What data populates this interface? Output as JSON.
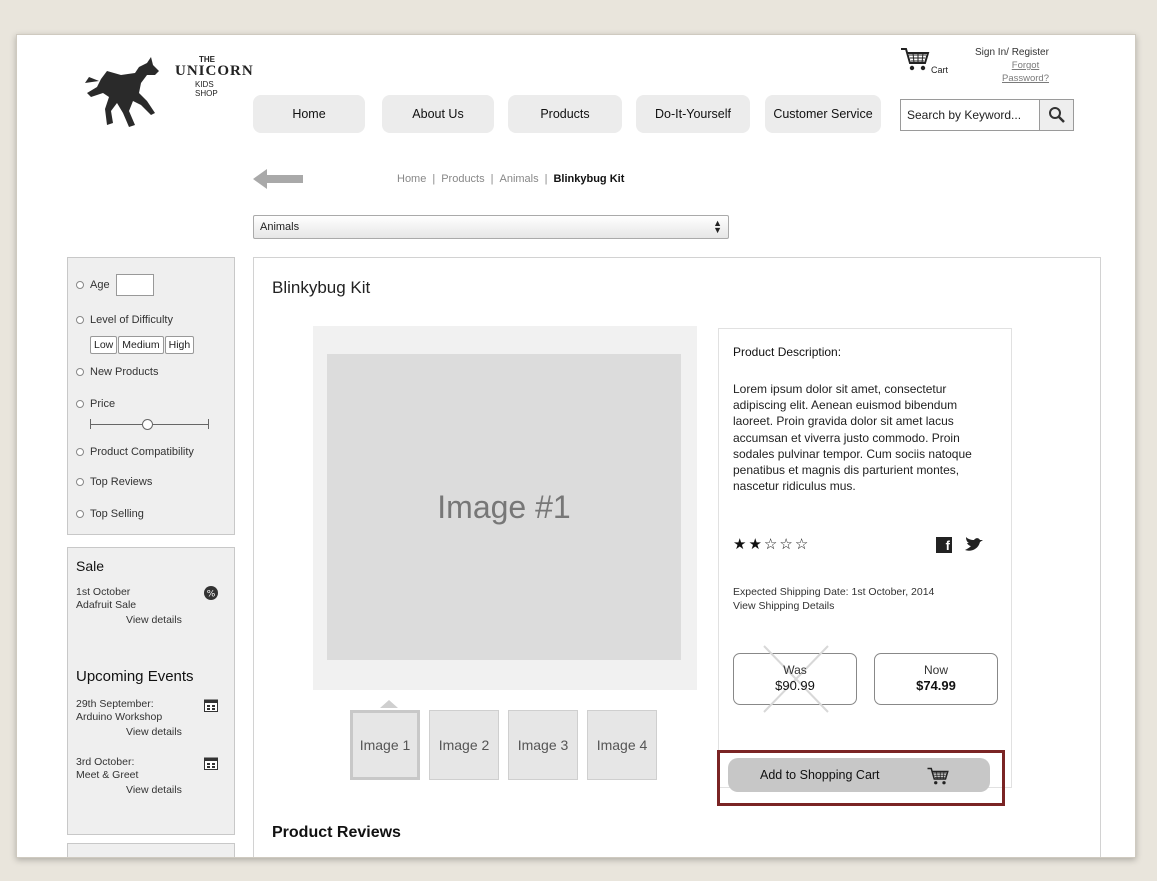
{
  "logo": {
    "the": "THE",
    "name": "UNICORN",
    "sub": "KIDS SHOP"
  },
  "header": {
    "cart_label": "Cart",
    "sign_in": "Sign In/ Register",
    "forgot_line1": "Forgot",
    "forgot_line2": "Password?"
  },
  "nav": {
    "items": [
      "Home",
      "About Us",
      "Products",
      "Do-It-Yourself",
      "Customer Service"
    ]
  },
  "search": {
    "placeholder": "Search by Keyword..."
  },
  "breadcrumb": {
    "items": [
      "Home",
      "Products",
      "Animals"
    ],
    "separator": "|",
    "current": "Blinkybug Kit"
  },
  "category_select": {
    "value": "Animals"
  },
  "filters": {
    "age": "Age",
    "difficulty": "Level of Difficulty",
    "difficulty_options": [
      "Low",
      "Medium",
      "High"
    ],
    "new_products": "New Products",
    "price": "Price",
    "compatibility": "Product Compatibility",
    "top_reviews": "Top Reviews",
    "top_selling": "Top Selling"
  },
  "sale": {
    "title": "Sale",
    "date": "1st October",
    "name": "Adafruit Sale",
    "link": "View details"
  },
  "events": {
    "title": "Upcoming Events",
    "items": [
      {
        "date": "29th September:",
        "name": "Arduino Workshop",
        "link": "View details"
      },
      {
        "date": "3rd October:",
        "name": "Meet & Greet",
        "link": "View details"
      }
    ]
  },
  "product": {
    "title": "Blinkybug Kit",
    "main_image": "Image #1",
    "thumbs": [
      "Image 1",
      "Image 2",
      "Image 3",
      "Image 4"
    ],
    "desc_head": "Product Description:",
    "description": "Lorem ipsum dolor sit amet, consectetur adipiscing elit. Aenean euismod bibendum laoreet. Proin gravida dolor sit amet lacus accumsan et viverra justo commodo. Proin sodales pulvinar tempor. Cum sociis natoque penatibus et magnis dis parturient montes, nascetur ridiculus mus.",
    "rating": 2,
    "rating_max": 5,
    "shipping": "Expected Shipping Date: 1st October, 2014",
    "shipping_link": "View Shipping Details",
    "was_label": "Was",
    "was_price": "$90.99",
    "now_label": "Now",
    "now_price": "$74.99",
    "add_to_cart": "Add to Shopping Cart",
    "reviews_head": "Product Reviews"
  },
  "colors": {
    "highlight": "#7a2424",
    "button": "#c7c7c7"
  }
}
